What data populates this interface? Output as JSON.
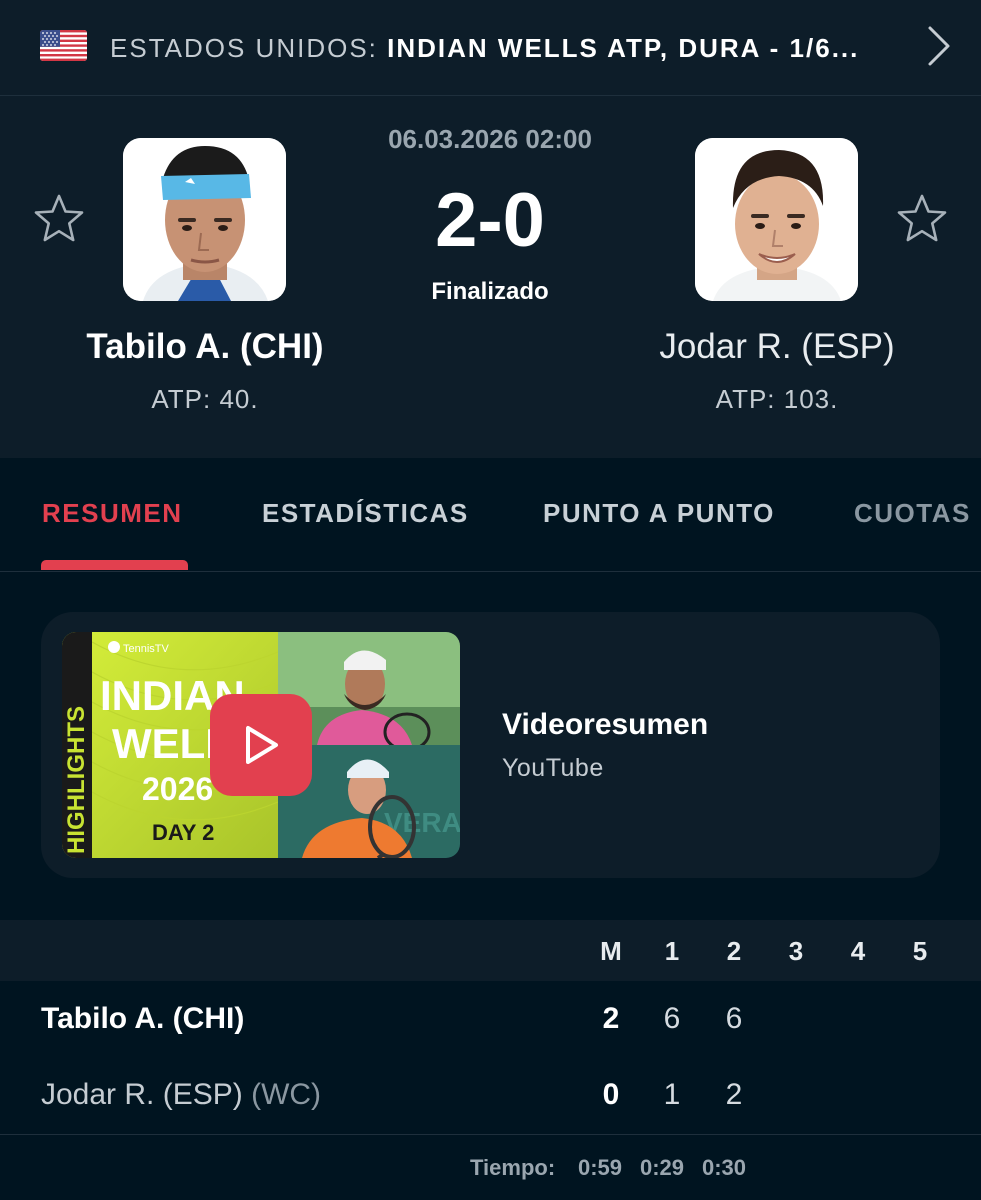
{
  "header": {
    "country": "ESTADOS UNIDOS:",
    "event": "INDIAN WELLS ATP, DURA - 1/6..."
  },
  "match": {
    "datetime": "06.03.2026 02:00",
    "score": "2-0",
    "status": "Finalizado",
    "home": {
      "name": "Tabilo A. (CHI)",
      "rank": "ATP: 40."
    },
    "away": {
      "name": "Jodar R. (ESP)",
      "rank": "ATP: 103."
    }
  },
  "tabs": [
    {
      "label": "RESUMEN",
      "active": true
    },
    {
      "label": "ESTADÍSTICAS",
      "active": false
    },
    {
      "label": "PUNTO A PUNTO",
      "active": false
    },
    {
      "label": "CUOTAS",
      "active": false
    }
  ],
  "video": {
    "title": "Videoresumen",
    "source": "YouTube",
    "thumbnail": {
      "brand": "TennisTV",
      "side_text": "HIGHLIGHTS",
      "line1": "INDIAN",
      "line2": "WELLS",
      "year": "2026",
      "day": "DAY 2",
      "bg_text": "VERA"
    }
  },
  "scoreboard": {
    "columns": [
      "M",
      "1",
      "2",
      "3",
      "4",
      "5"
    ],
    "rows": [
      {
        "name": "Tabilo A. (CHI)",
        "tag": "",
        "m": "2",
        "sets": [
          "6",
          "6"
        ]
      },
      {
        "name": "Jodar R. (ESP)",
        "tag": "(WC)",
        "m": "0",
        "sets": [
          "1",
          "2"
        ]
      }
    ],
    "time_label": "Tiempo:",
    "times": [
      "0:59",
      "0:29",
      "0:30"
    ]
  },
  "colors": {
    "background": "#001420",
    "panel": "#0d1d29",
    "accent": "#e2404f",
    "thumb_green": "#c8e332",
    "play_red": "#e2404f"
  },
  "icons": [
    "us-flag-icon",
    "chevron-right-icon",
    "star-outline-icon",
    "play-icon",
    "tennistv-logo-icon"
  ]
}
